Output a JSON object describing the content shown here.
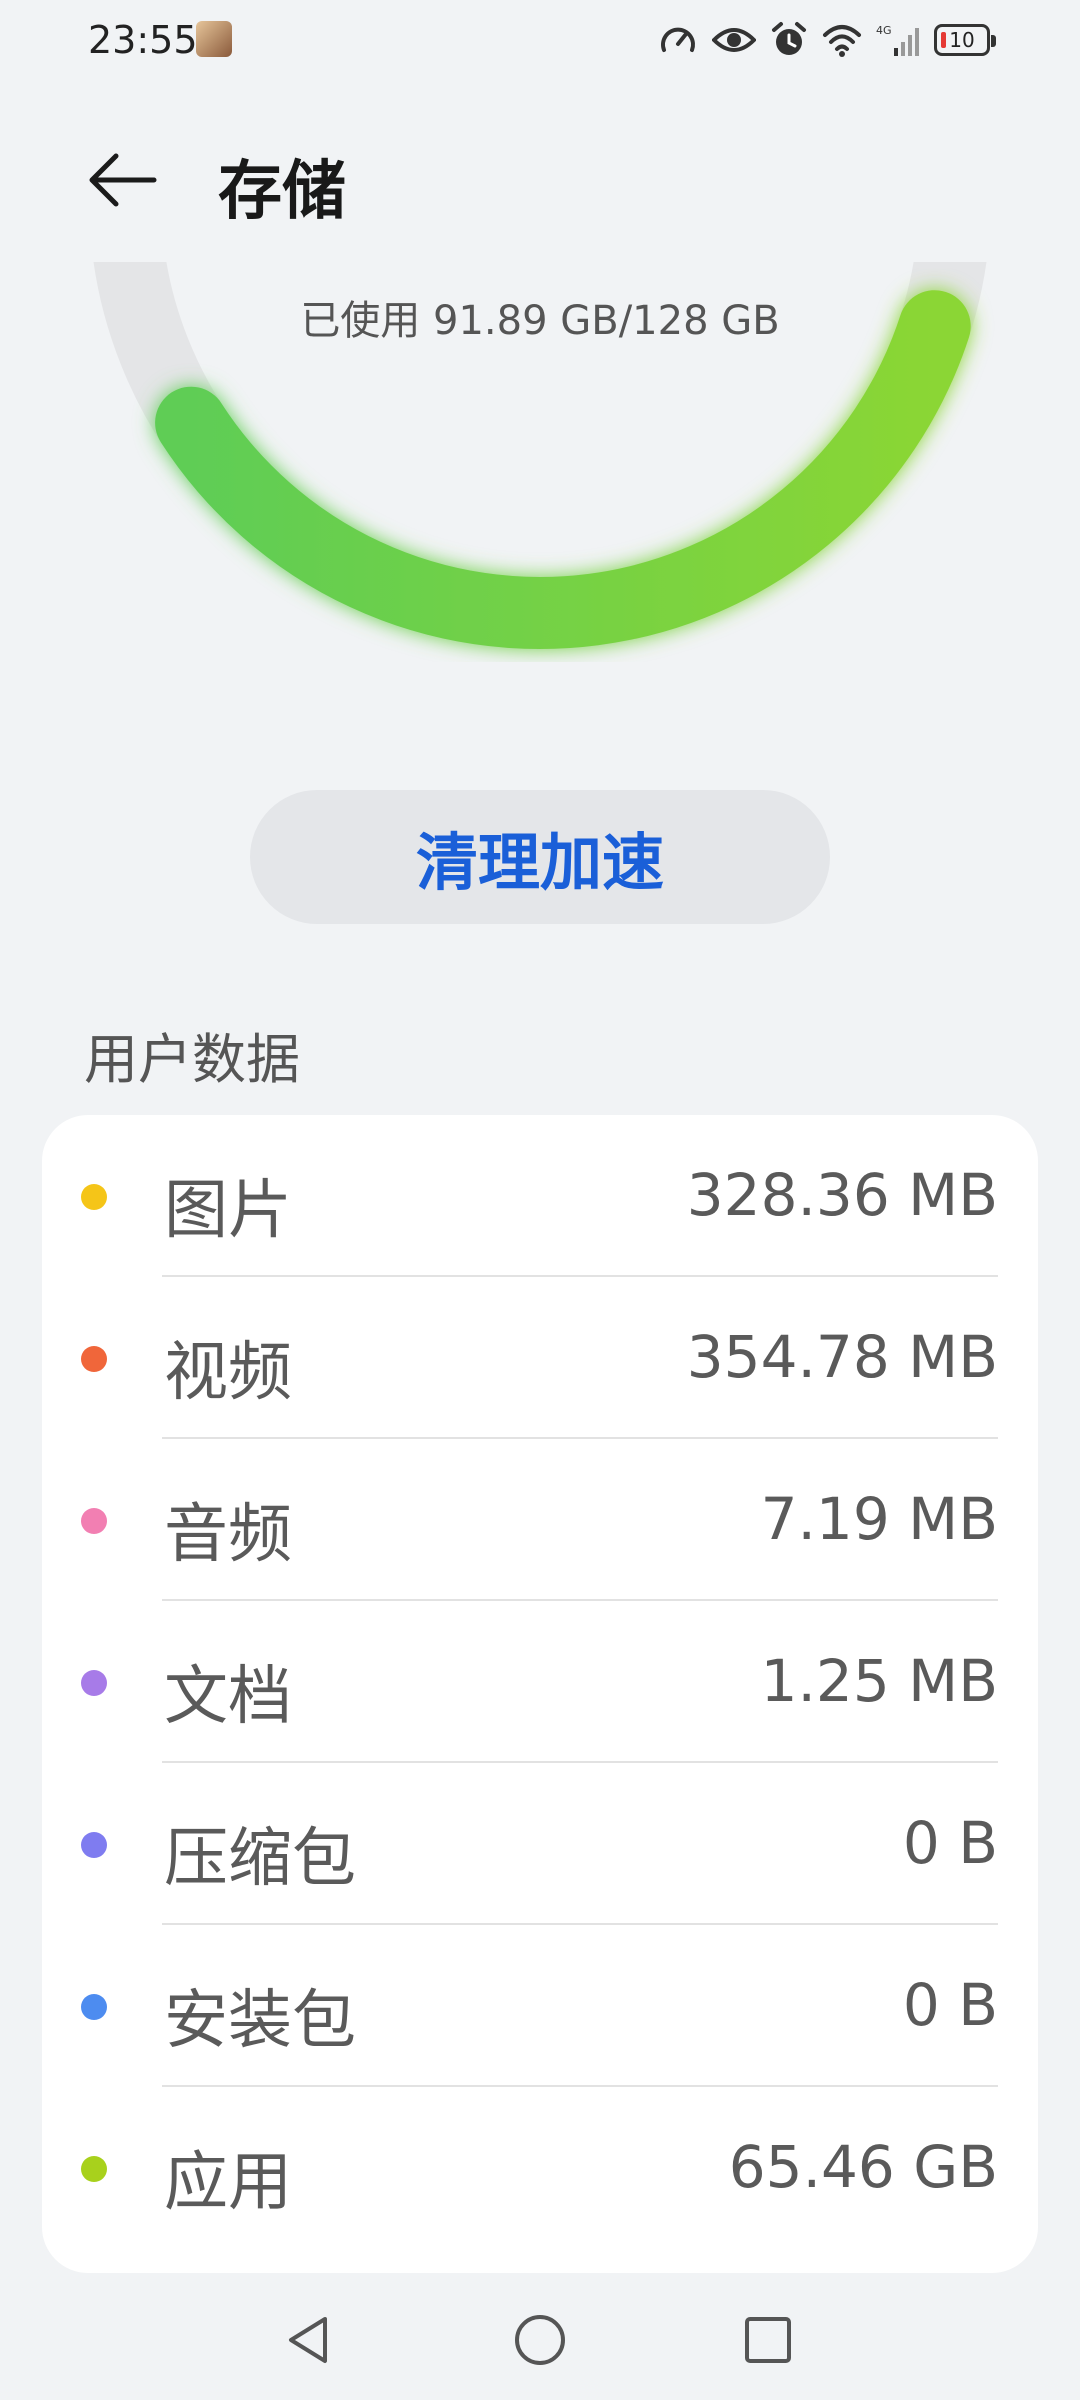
{
  "status_bar": {
    "time": "23:55",
    "battery": "10"
  },
  "header": {
    "title": "存储"
  },
  "storage": {
    "used_text": "已使用 91.89 GB/128 GB",
    "used_gb": 91.89,
    "total_gb": 128
  },
  "clean_button": {
    "label": "清理加速"
  },
  "user_data": {
    "section_title": "用户数据",
    "items": [
      {
        "label": "图片",
        "value": "328.36 MB",
        "color": "#f5c518"
      },
      {
        "label": "视频",
        "value": "354.78 MB",
        "color": "#f0663a"
      },
      {
        "label": "音频",
        "value": "7.19 MB",
        "color": "#f27fb2"
      },
      {
        "label": "文档",
        "value": "1.25 MB",
        "color": "#a77be8"
      },
      {
        "label": "压缩包",
        "value": "0 B",
        "color": "#7f7cf0"
      },
      {
        "label": "安装包",
        "value": "0 B",
        "color": "#4d8cf0"
      },
      {
        "label": "应用",
        "value": "65.46 GB",
        "color": "#a8d11c"
      }
    ]
  },
  "colors": {
    "accent": "#1a5fd8",
    "gauge_used": "#6ccf4a",
    "gauge_track": "#e4e5e7"
  },
  "nav": {
    "icons": [
      "back-triangle-icon",
      "home-circle-icon",
      "recents-square-icon"
    ]
  }
}
